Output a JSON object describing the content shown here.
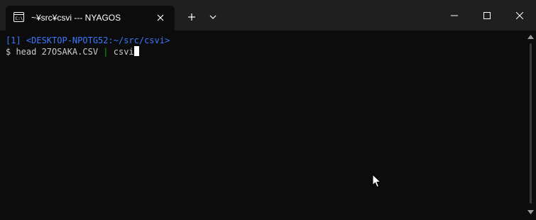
{
  "window": {
    "tab_title": "~¥src¥csvi --- NYAGOS",
    "tab_icon": "terminal-icon",
    "new_tab_icon": "plus-icon",
    "dropdown_icon": "chevron-down-icon",
    "controls": [
      "minimize-icon",
      "maximize-icon",
      "close-icon"
    ]
  },
  "terminal": {
    "prompt_line": "[1] <DESKTOP-NPOTG52:~/src/csvi>",
    "prompt_symbol": "$",
    "command_part1": " head 27OSAKA.CSV ",
    "pipe": "|",
    "command_part2": " csvi"
  },
  "colors": {
    "background": "#0c0c0c",
    "titlebar": "#1f1f1f",
    "prompt": "#3b78ff",
    "text": "#cccccc",
    "pipe": "#13a10e"
  }
}
